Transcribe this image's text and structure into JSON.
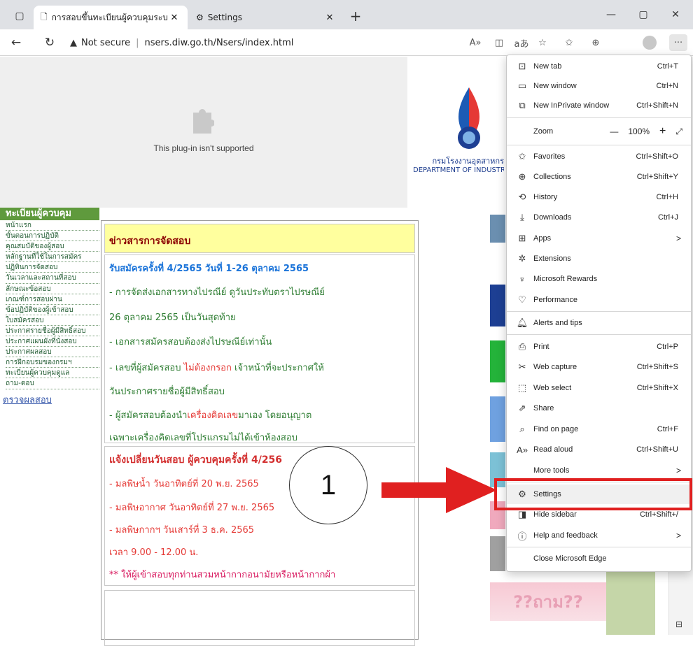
{
  "browser": {
    "tabs": [
      {
        "title": "การสอบขึ้นทะเบียนผู้ควบคุมระบบบำบัด",
        "active": true
      },
      {
        "title": "Settings",
        "active": false
      }
    ],
    "address": {
      "security": "Not secure",
      "url": "nsers.diw.go.th/Nsers/index.html"
    }
  },
  "page": {
    "plugin_message": "This plug-in isn't supported",
    "logo": {
      "th": "กรมโรงงานอุตสาหกร",
      "en": "DEPARTMENT OF INDUSTRIA"
    },
    "left_menu": {
      "header": "ทะเบียนผู้ควบคุม",
      "items": [
        "หน้าแรก",
        "ขั้นตอนการปฏิบัติ",
        "คุณสมบัติของผู้สอบ",
        "หลักฐานที่ใช้ในการสมัคร",
        "ปฏิทินการจัดสอบ",
        "วันเวลาและสถานที่สอบ",
        "ลักษณะข้อสอบ",
        "เกณฑ์การสอบผ่าน",
        "ข้อปฏิบัติของผู้เข้าสอบ",
        "ใบสมัครสอบ",
        "ประกาศรายชื่อผู้มีสิทธิ์สอบ",
        "ประกาศแผนผังที่นั่งสอบ",
        "ประกาศผลสอบ",
        "การฝึกอบรมของกรมฯ",
        "ทะเบียนผู้ควบคุมดูแล",
        "ถาม-ตอบ"
      ],
      "check_link": "ตรวจผลสอบ"
    },
    "news": {
      "header": "ข่าวสารการจัดสอบ",
      "section1": [
        "รับสมัครครั้งที่ 4/2565 วันที่ 1-26 ตุลาคม 2565",
        "- การจัดส่งเอกสารทางไปรณีย์ ดูวันประทับตราไปรษณีย์",
        "26 ตุลาคม 2565 เป็นวันสุดท้าย",
        "- เอกสารสมัครสอบต้องส่งไปรษณีย์เท่านั้น",
        "- เลขที่ผู้สมัครสอบ ",
        "ไม่ต้องกรอก",
        " เจ้าหน้าที่จะประกาศให้",
        "วันประกาศรายชื่อผู้มีสิทธิ์สอบ",
        "- ผู้สมัครสอบต้องนำ",
        "เครื่องคิดเลข",
        "มาเอง โดยอนุญาต",
        "เฉพาะเครื่องคิดเลขที่โปรแกรมไม่ได้เข้าห้องสอบ"
      ],
      "section2": [
        "แจ้งเปลี่ยนวันสอบ ผู้ควบคุมครั้งที่ 4/256",
        "- มลพิษน้ำ วันอาทิตย์ที่ 20 พ.ย. 2565",
        "- มลพิษอากาศ วันอาทิตย์ที่ 27 พ.ย. 2565",
        "- มลพิษกากฯ วันเสาร์ที่ 3 ธ.ค. 2565",
        "เวลา 9.00 - 12.00 น.",
        "** ให้ผู้เข้าสอบทุกท่านสวมหน้ากากอนามัยหรือหน้ากากผ้า"
      ],
      "toon": "??ถาม??"
    }
  },
  "menu": {
    "items": [
      {
        "icon": "new-tab-icon",
        "label": "New tab",
        "shortcut": "Ctrl+T"
      },
      {
        "icon": "new-window-icon",
        "label": "New window",
        "shortcut": "Ctrl+N"
      },
      {
        "icon": "inprivate-icon",
        "label": "New InPrivate window",
        "shortcut": "Ctrl+Shift+N"
      },
      {
        "icon": "zoom",
        "label": "Zoom",
        "zoom": "100%"
      },
      {
        "icon": "favorites-icon",
        "label": "Favorites",
        "shortcut": "Ctrl+Shift+O"
      },
      {
        "icon": "collections-icon",
        "label": "Collections",
        "shortcut": "Ctrl+Shift+Y"
      },
      {
        "icon": "history-icon",
        "label": "History",
        "shortcut": "Ctrl+H"
      },
      {
        "icon": "downloads-icon",
        "label": "Downloads",
        "shortcut": "Ctrl+J"
      },
      {
        "icon": "apps-icon",
        "label": "Apps",
        "arrow": ">"
      },
      {
        "icon": "extensions-icon",
        "label": "Extensions"
      },
      {
        "icon": "rewards-icon",
        "label": "Microsoft Rewards"
      },
      {
        "icon": "performance-icon",
        "label": "Performance"
      },
      {
        "icon": "alerts-icon",
        "label": "Alerts and tips"
      },
      {
        "icon": "print-icon",
        "label": "Print",
        "shortcut": "Ctrl+P"
      },
      {
        "icon": "web-capture-icon",
        "label": "Web capture",
        "shortcut": "Ctrl+Shift+S"
      },
      {
        "icon": "web-select-icon",
        "label": "Web select",
        "shortcut": "Ctrl+Shift+X"
      },
      {
        "icon": "share-icon",
        "label": "Share"
      },
      {
        "icon": "find-icon",
        "label": "Find on page",
        "shortcut": "Ctrl+F"
      },
      {
        "icon": "read-aloud-icon",
        "label": "Read aloud",
        "shortcut": "Ctrl+Shift+U"
      },
      {
        "icon": "more-tools",
        "label": "More tools",
        "arrow": ">"
      },
      {
        "icon": "settings-icon",
        "label": "Settings"
      },
      {
        "icon": "sidebar-icon",
        "label": "Hide sidebar",
        "shortcut": "Ctrl+Shift+/"
      },
      {
        "icon": "help-icon",
        "label": "Help and feedback",
        "arrow": ">"
      },
      {
        "icon": "close-edge",
        "label": "Close Microsoft Edge"
      }
    ]
  },
  "annotation": {
    "step_number": "1",
    "highlight_color": "#e02020"
  }
}
